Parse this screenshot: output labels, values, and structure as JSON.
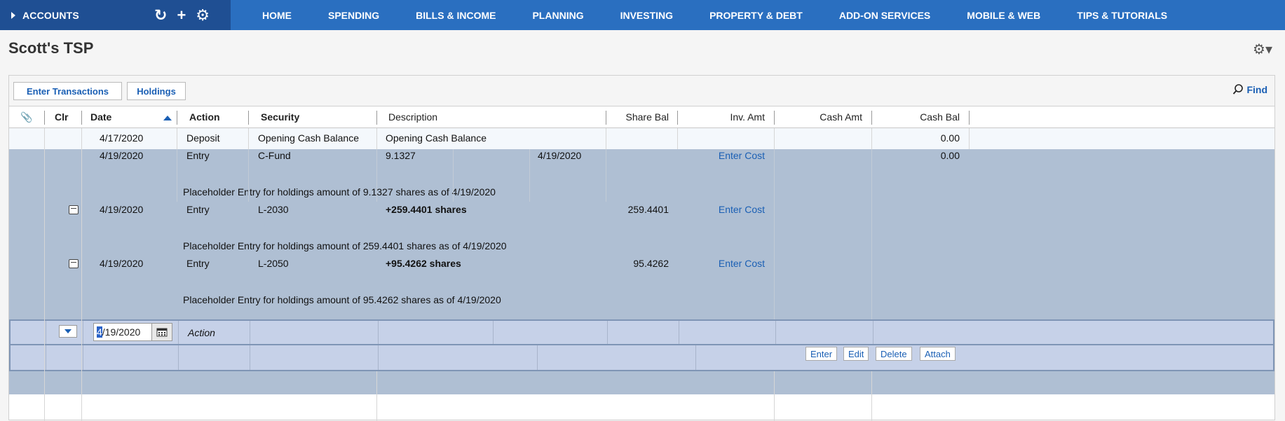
{
  "topnav": {
    "accounts_label": "ACCOUNTS",
    "tools": {
      "refresh": "↻",
      "add": "+",
      "settings": "⚙"
    },
    "items": [
      "HOME",
      "SPENDING",
      "BILLS & INCOME",
      "PLANNING",
      "INVESTING",
      "PROPERTY & DEBT",
      "ADD-ON SERVICES",
      "MOBILE & WEB",
      "TIPS & TUTORIALS"
    ]
  },
  "page": {
    "title": "Scott's TSP",
    "gear_menu": "⚙▾"
  },
  "toolbar": {
    "enter_transactions": "Enter Transactions",
    "holdings": "Holdings",
    "find": "Find"
  },
  "columns": {
    "attach": "📎",
    "clr": "Clr",
    "date": "Date",
    "action": "Action",
    "security": "Security",
    "description": "Description",
    "share_bal": "Share Bal",
    "inv_amt": "Inv. Amt",
    "cash_amt": "Cash Amt",
    "cash_bal": "Cash Bal"
  },
  "transactions": [
    {
      "date": "4/17/2020",
      "action": "Deposit",
      "security": "Opening Cash Balance",
      "description": "Opening Cash Balance",
      "cash_bal": "0.00"
    },
    {
      "date": "4/19/2020",
      "action": "Entry",
      "security": "C-Fund",
      "description": "9.1327",
      "description_date": "4/19/2020",
      "inv_amt": "Enter Cost",
      "cash_bal": "0.00",
      "memo": "Placeholder Entry for holdings amount of 9.1327 shares as of 4/19/2020"
    },
    {
      "date": "4/19/2020",
      "action": "Entry",
      "security": "L-2030",
      "description": "+259.4401 shares",
      "share_bal": "259.4401",
      "inv_amt": "Enter Cost",
      "memo": "Placeholder Entry for holdings amount of 259.4401 shares as of 4/19/2020"
    },
    {
      "date": "4/19/2020",
      "action": "Entry",
      "security": "L-2050",
      "description": "+95.4262 shares",
      "share_bal": "95.4262",
      "inv_amt": "Enter Cost",
      "memo": "Placeholder Entry for holdings amount of 95.4262 shares as of 4/19/2020"
    }
  ],
  "editor": {
    "date_value_cursor": "4",
    "date_value_rest": "/19/2020",
    "action_placeholder": "Action",
    "buttons": {
      "enter": "Enter",
      "edit": "Edit",
      "delete": "Delete",
      "attach": "Attach"
    }
  }
}
